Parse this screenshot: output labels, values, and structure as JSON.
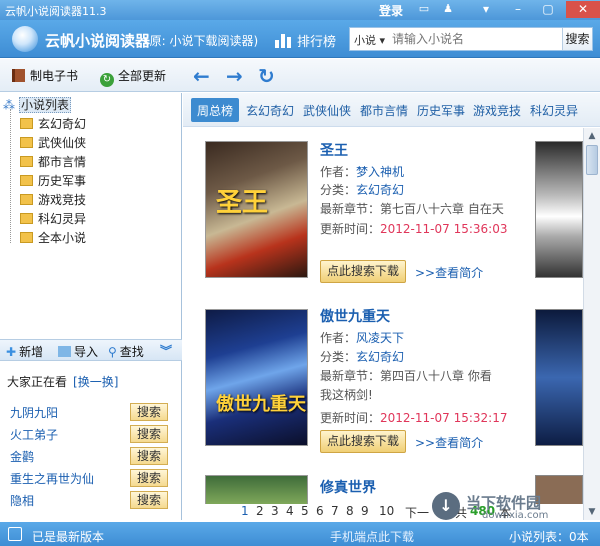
{
  "window": {
    "title": "云帆小说阅读器11.3",
    "login": "登录",
    "min": "–",
    "close": "✕"
  },
  "header": {
    "app_name": "云帆小说阅读器",
    "app_sub": "(原: 小说下载阅读器)",
    "ranking": "排行榜",
    "search_category": "小说 ▾",
    "search_placeholder": "请输入小说名",
    "search_button": "搜索"
  },
  "toolbar": {
    "make_ebook": "制电子书",
    "update_all": "全部更新"
  },
  "tree": {
    "root": "小说列表",
    "items": [
      "玄幻奇幻",
      "武侠仙侠",
      "都市言情",
      "历史军事",
      "游戏竞技",
      "科幻灵异",
      "全本小说"
    ]
  },
  "side_tools": {
    "add": "新增",
    "import": "导入",
    "find": "查找"
  },
  "watching": {
    "title": "大家正在看",
    "change": "[换一换]",
    "items": [
      "九阴九阳",
      "火工弟子",
      "金鹳",
      "重生之再世为仙",
      "隐相"
    ],
    "btn": "搜索"
  },
  "tabs": [
    "周总榜",
    "玄幻奇幻",
    "武侠仙侠",
    "都市言情",
    "历史军事",
    "游戏竞技",
    "科幻灵异"
  ],
  "labels": {
    "author": "作者：",
    "category": "分类：",
    "latest": "最新章节：",
    "updated": "更新时间：",
    "download": "点此搜索下载",
    "intro": ">>查看简介"
  },
  "books": [
    {
      "title": "圣王",
      "author": "梦入神机",
      "category": "玄幻奇幻",
      "latest": "第七百八十六章 自在天",
      "updated": "2012-11-07 15:36:03",
      "cover_text": "圣王"
    },
    {
      "title": "傲世九重天",
      "author": "风凌天下",
      "category": "玄幻奇幻",
      "latest": "第四百八十八章 你看我这柄剑!",
      "updated": "2012-11-07 15:32:17",
      "cover_text": "傲世九重天"
    },
    {
      "title": "修真世界"
    }
  ],
  "pager": {
    "pages": [
      "1",
      "2",
      "3",
      "4",
      "5",
      "6",
      "7",
      "8",
      "9",
      "10"
    ],
    "next": "下一",
    "count_prefix": "共",
    "count": "480",
    "count_suffix": "本"
  },
  "status": {
    "version": "已是最新版本",
    "mobile": "手机端点此下载",
    "list_count": "小说列表：0本"
  },
  "watermark": {
    "name": "当下软件园",
    "url": "downxia.com"
  }
}
